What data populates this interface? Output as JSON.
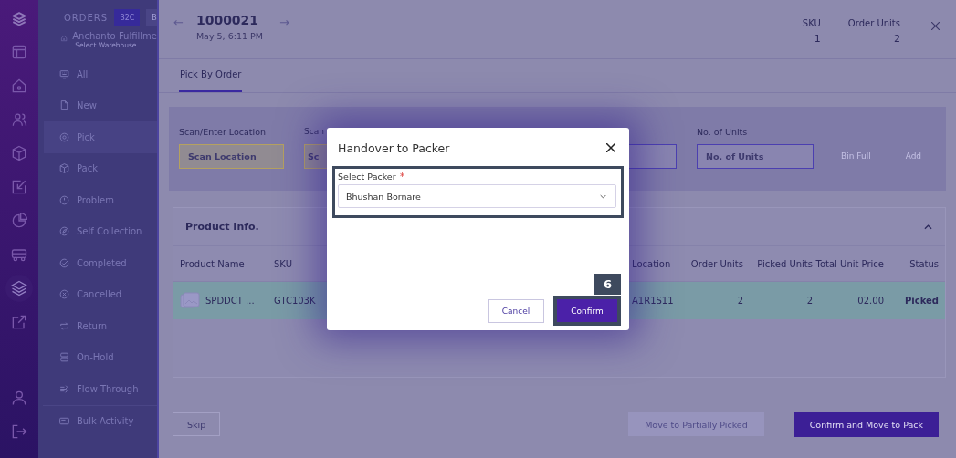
{
  "rail": {
    "items": [
      {
        "selected": false
      },
      {
        "selected": false
      },
      {
        "selected": false
      },
      {
        "selected": false
      },
      {
        "selected": false
      },
      {
        "selected": false
      },
      {
        "selected": false
      },
      {
        "selected": false
      },
      {
        "selected": true
      },
      {
        "selected": false
      }
    ],
    "bottom_items": [
      {
        "selected": false
      },
      {
        "selected": false
      }
    ]
  },
  "sidebar": {
    "title": "ORDERS",
    "tabs": [
      {
        "label": "B2C",
        "selected": true
      },
      {
        "label": "B",
        "selected": false
      }
    ],
    "warehouse": {
      "name": "Anchanto Fulfillme",
      "hint": "Select Warehouse"
    },
    "items": [
      {
        "label": "All",
        "selected": false
      },
      {
        "label": "New",
        "selected": false
      },
      {
        "label": "Pick",
        "selected": true
      },
      {
        "label": "Pack",
        "selected": false
      },
      {
        "label": "Problem",
        "selected": false
      },
      {
        "label": "Self Collection",
        "selected": false
      },
      {
        "label": "Completed",
        "selected": false
      },
      {
        "label": "Cancelled",
        "selected": false
      },
      {
        "label": "Return",
        "selected": false
      },
      {
        "label": "On-Hold",
        "selected": false
      },
      {
        "label": "Flow Through",
        "selected": false
      }
    ],
    "footer_items": [
      {
        "label": "Bulk Activity",
        "selected": false
      }
    ]
  },
  "order": {
    "prev": "←",
    "number": "1000021",
    "date": "May 5, 6:11 PM",
    "next": "→",
    "stats": [
      {
        "label": "SKU",
        "value": "1"
      },
      {
        "label": "Order Units",
        "value": "2"
      }
    ]
  },
  "tabs": [
    {
      "label": "Pick By Order",
      "selected": true
    }
  ],
  "scan_panel": {
    "fields": [
      {
        "label": "Scan/Enter Location",
        "placeholder": "Scan Location",
        "kind": "warning"
      },
      {
        "label": "Scan",
        "placeholder": "Sc",
        "kind": "warning"
      },
      {
        "kind": "primary"
      },
      {
        "label": "No. of Units",
        "placeholder": "No. of Units",
        "kind": "primary"
      }
    ],
    "buttons": [
      {
        "label": "Bin Full",
        "disabled": true
      },
      {
        "label": "Add",
        "disabled": true
      }
    ]
  },
  "product_info": {
    "title": "Product Info.",
    "expanded": true,
    "columns": [
      "Product Name",
      "SKU",
      "Location",
      "Order Units",
      "Picked Units",
      "Total Unit Price",
      "Status"
    ],
    "rows": [
      {
        "selected": true,
        "cells": [
          "SPDDCT ...",
          "GTC103K",
          "A1R1S11",
          "2",
          "2",
          "02.00",
          "Picked"
        ]
      }
    ]
  },
  "actions": {
    "skip": "Skip",
    "partial": {
      "label": "Move to Partially Picked",
      "disabled": true
    },
    "confirm": "Confirm and Move to Pack"
  },
  "modal": {
    "title": "Handover to Packer",
    "field": {
      "label": "Select Packer",
      "required": true,
      "value": "Bhushan Bornare"
    },
    "buttons": [
      {
        "label": "Cancel",
        "kind": "secondary"
      },
      {
        "label": "Confirm",
        "kind": "primary"
      }
    ],
    "callout": {
      "step": "6"
    }
  }
}
